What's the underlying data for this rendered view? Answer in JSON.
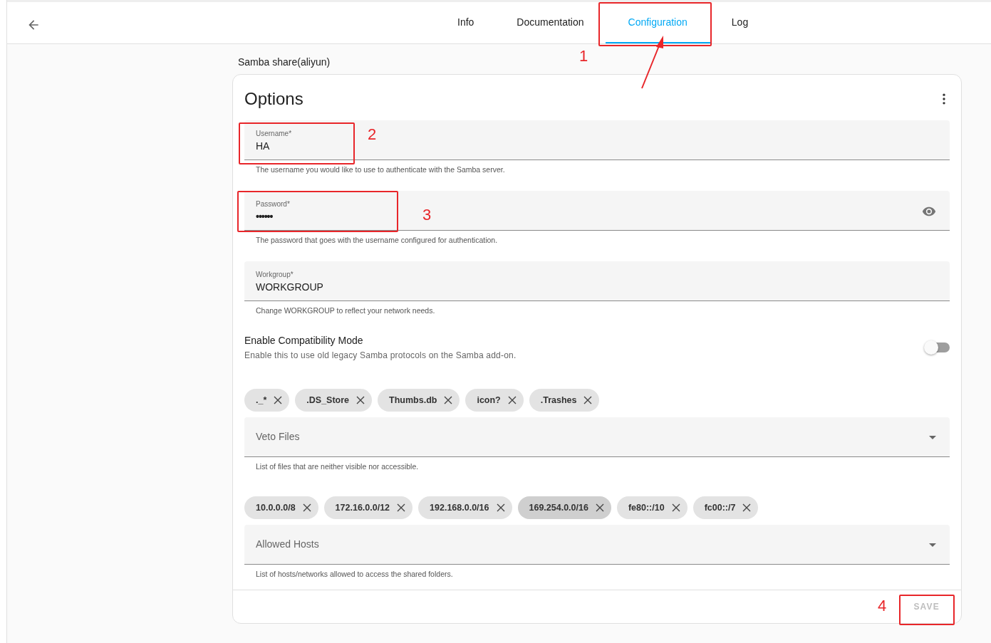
{
  "header": {
    "tabs": [
      {
        "label": "Info",
        "selected": false
      },
      {
        "label": "Documentation",
        "selected": false
      },
      {
        "label": "Configuration",
        "selected": true
      },
      {
        "label": "Log",
        "selected": false
      }
    ]
  },
  "page_title": "Samba share(aliyun)",
  "card": {
    "title": "Options",
    "fields": [
      {
        "kind": "text",
        "label": "Username*",
        "value": "HA",
        "helper": "The username you would like to use to authenticate with the Samba server."
      },
      {
        "kind": "password",
        "label": "Password*",
        "value": "••••••",
        "helper": "The password that goes with the username configured for authentication."
      },
      {
        "kind": "text",
        "label": "Workgroup*",
        "value": "WORKGROUP",
        "helper": "Change WORKGROUP to reflect your network needs."
      },
      {
        "kind": "toggle",
        "label": "Enable Compatibility Mode",
        "description": "Enable this to use old legacy Samba protocols on the Samba add-on.",
        "on": false
      },
      {
        "kind": "chips",
        "label": "Veto Files",
        "helper": "List of files that are neither visible nor accessible.",
        "chips": [
          {
            "label": "._*",
            "selected": false
          },
          {
            "label": ".DS_Store",
            "selected": false
          },
          {
            "label": "Thumbs.db",
            "selected": false
          },
          {
            "label": "icon?",
            "selected": false
          },
          {
            "label": ".Trashes",
            "selected": false
          }
        ]
      },
      {
        "kind": "chips",
        "label": "Allowed Hosts",
        "helper": "List of hosts/networks allowed to access the shared folders.",
        "chips": [
          {
            "label": "10.0.0.0/8",
            "selected": false
          },
          {
            "label": "172.16.0.0/12",
            "selected": false
          },
          {
            "label": "192.168.0.0/16",
            "selected": false
          },
          {
            "label": "169.254.0.0/16",
            "selected": true
          },
          {
            "label": "fe80::/10",
            "selected": false
          },
          {
            "label": "fc00::/7",
            "selected": false
          }
        ]
      }
    ],
    "save_button": {
      "label": "SAVE",
      "disabled": true
    }
  },
  "annotations": [
    {
      "number": "1"
    },
    {
      "number": "2"
    },
    {
      "number": "3"
    },
    {
      "number": "4"
    }
  ]
}
